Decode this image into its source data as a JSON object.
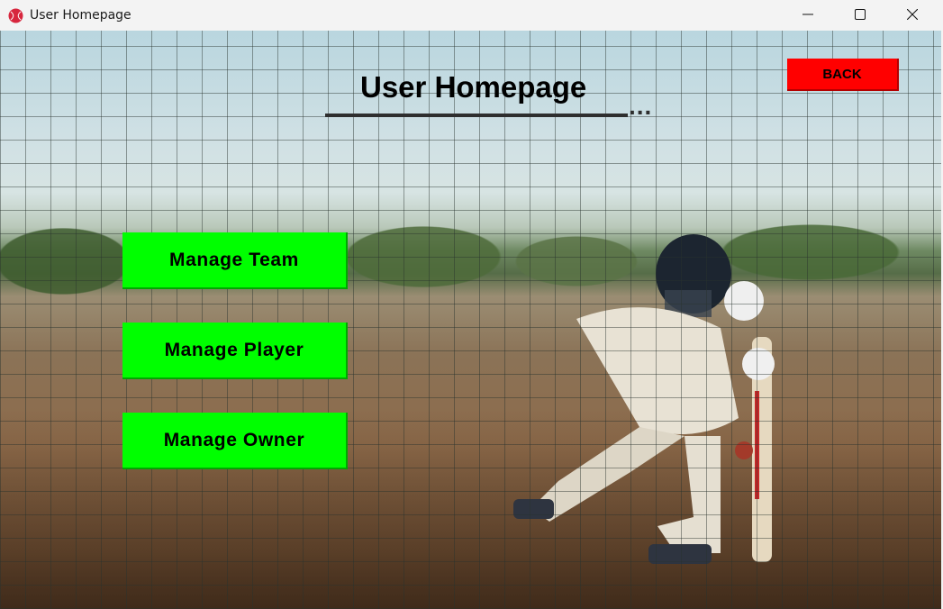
{
  "window": {
    "title": "User Homepage",
    "icon": "cricket-ball-icon",
    "controls": [
      "minimize-icon",
      "maximize-icon",
      "close-icon"
    ]
  },
  "page": {
    "heading": "User Homepage",
    "heading_suffix": "...",
    "back_label": "BACK"
  },
  "menu": {
    "items": [
      {
        "label": "Manage Team"
      },
      {
        "label": "Manage Player"
      },
      {
        "label": "Manage Owner"
      }
    ]
  },
  "colors": {
    "menu_button": "#00ff00",
    "back_button": "#ff0000",
    "heading_text": "#000000"
  }
}
